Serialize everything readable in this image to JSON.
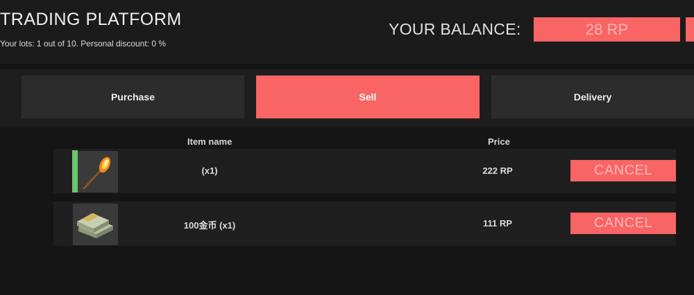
{
  "header": {
    "title": "TRADING PLATFORM",
    "subtitle": "Your lots: 1 out of 10. Personal discount: 0 %",
    "balance_label": "YOUR BALANCE:",
    "balance_value": "28 RP"
  },
  "tabs": [
    {
      "label": "Purchase",
      "active": false
    },
    {
      "label": "Sell",
      "active": true
    },
    {
      "label": "Delivery",
      "active": false
    }
  ],
  "table": {
    "columns": [
      "Item name",
      "Price"
    ],
    "rows": [
      {
        "icon": "flaming-torch-icon",
        "name": "(x1)",
        "price": "222 RP",
        "action": "CANCEL"
      },
      {
        "icon": "money-stack-icon",
        "name": "100金币 (x1)",
        "price": "111 RP",
        "action": "CANCEL"
      }
    ]
  },
  "colors": {
    "accent": "#f96464",
    "rarity_green": "#6cc56c",
    "background": "#151515"
  }
}
